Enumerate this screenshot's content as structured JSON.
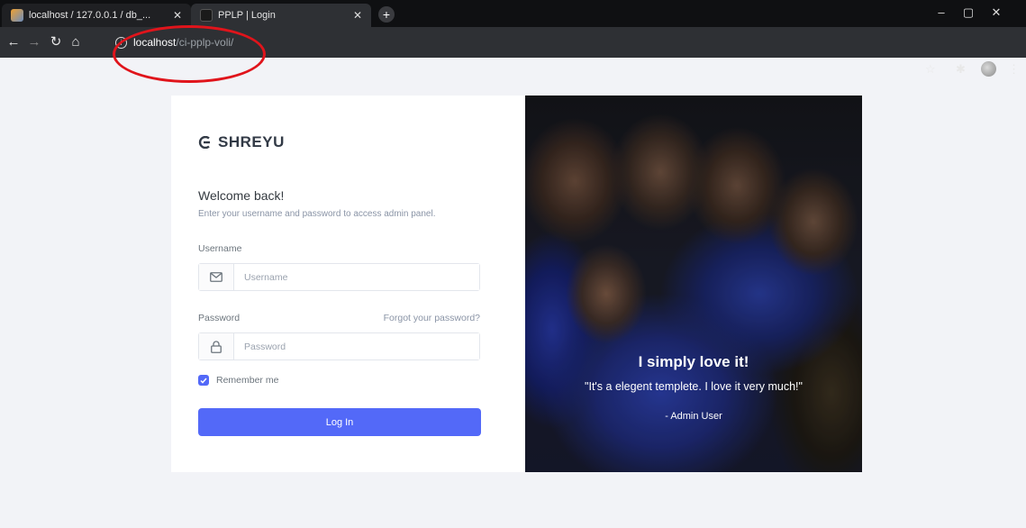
{
  "browser": {
    "tabs": [
      {
        "title": "localhost / 127.0.0.1 / db_...",
        "active": false
      },
      {
        "title": "PPLP | Login",
        "active": true
      }
    ],
    "url_host": "localhost",
    "url_path": "/ci-pplp-voli/",
    "window_controls": {
      "minimize": "–",
      "maximize": "▢",
      "close": "✕"
    }
  },
  "brand": {
    "name": "SHREYU"
  },
  "login": {
    "welcome": "Welcome back!",
    "subtitle": "Enter your username and password to access admin panel.",
    "username_label": "Username",
    "username_placeholder": "Username",
    "password_label": "Password",
    "forgot_link": "Forgot your password?",
    "password_placeholder": "Password",
    "remember_label": "Remember me",
    "remember_checked": true,
    "submit_label": "Log In"
  },
  "testimonial": {
    "title": "I simply love it!",
    "quote": "\"It's a elegent templete. I love it very much!\"",
    "author": "- Admin User"
  },
  "colors": {
    "accent": "#5369f8",
    "annotation": "#e0141b"
  }
}
